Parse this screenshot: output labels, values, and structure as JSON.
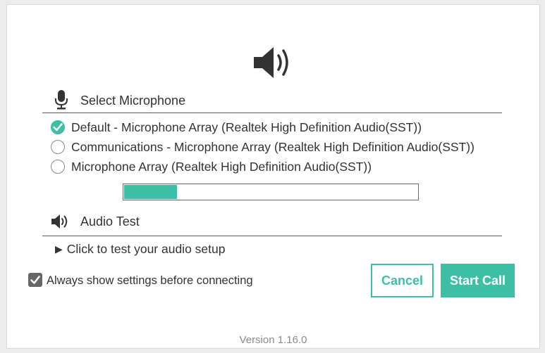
{
  "hero": {
    "icon": "speaker-volume-icon"
  },
  "microphone": {
    "title": "Select Microphone",
    "icon": "microphone-icon",
    "options": [
      {
        "label": "Default - Microphone Array (Realtek High Definition Audio(SST))",
        "selected": true
      },
      {
        "label": "Communications - Microphone Array (Realtek High Definition Audio(SST))",
        "selected": false
      },
      {
        "label": "Microphone Array (Realtek High Definition Audio(SST))",
        "selected": false
      }
    ],
    "level_fraction": 0.18
  },
  "audio_test": {
    "title": "Audio Test",
    "icon": "speaker-icon",
    "test_link": "Click to test your audio setup"
  },
  "settings": {
    "always_show_label": "Always show settings before connecting",
    "always_show_checked": true
  },
  "buttons": {
    "cancel": "Cancel",
    "start_call": "Start Call"
  },
  "version": "Version 1.16.0",
  "colors": {
    "accent": "#3dbfa5",
    "text": "#333333",
    "muted": "#8a8a8a"
  }
}
